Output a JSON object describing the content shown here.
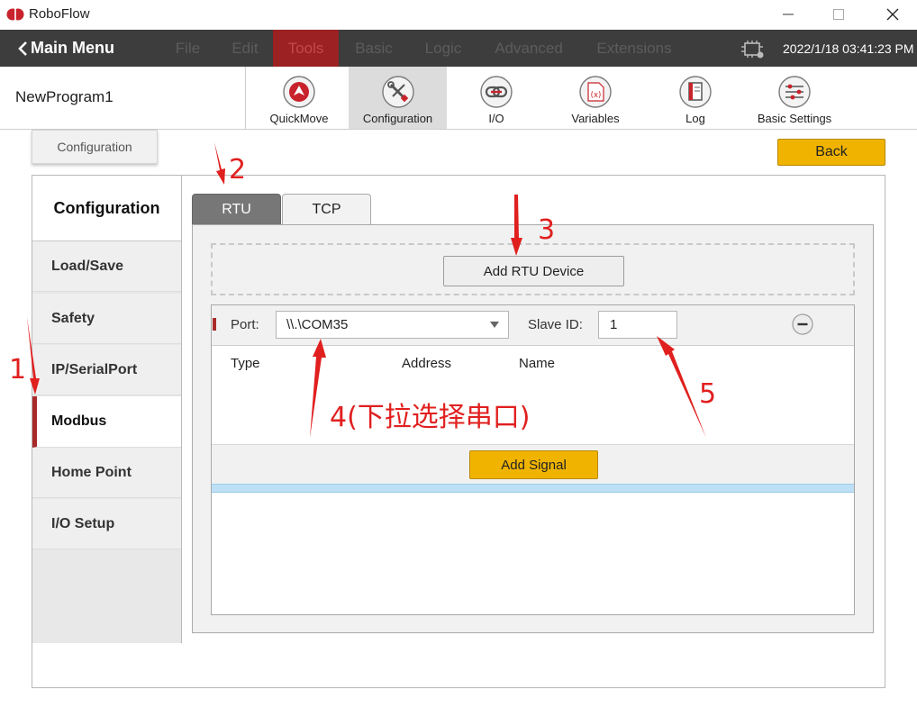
{
  "window": {
    "title": "RoboFlow",
    "controls": {
      "minimize": "minimize-icon",
      "maximize": "maximize-icon",
      "close": "close-icon"
    }
  },
  "menubar": {
    "main_menu": "Main Menu",
    "items": [
      "File",
      "Edit",
      "Tools",
      "Basic",
      "Logic",
      "Advanced",
      "Extensions"
    ],
    "active_item": "Tools",
    "datetime": "2022/1/18 03:41:23 PM"
  },
  "toolbar": {
    "program_name": "NewProgram1",
    "tools": [
      {
        "label": "QuickMove",
        "icon": "quickmove-icon"
      },
      {
        "label": "Configuration",
        "icon": "wrench-screwdriver-icon"
      },
      {
        "label": "I/O",
        "icon": "io-connector-icon"
      },
      {
        "label": "Variables",
        "icon": "variables-icon"
      },
      {
        "label": "Log",
        "icon": "log-book-icon"
      },
      {
        "label": "Basic Settings",
        "icon": "sliders-icon"
      }
    ],
    "active_tool": "Configuration"
  },
  "breadcrumb": "Configuration",
  "back_button": "Back",
  "sidebar": {
    "heading": "Configuration",
    "items": [
      "Load/Save",
      "Safety",
      "IP/SerialPort",
      "Modbus",
      "Home Point",
      "I/O Setup"
    ],
    "active_item": "Modbus"
  },
  "tabs": [
    "RTU",
    "TCP"
  ],
  "active_tab": "RTU",
  "rtu": {
    "add_device_button": "Add RTU Device",
    "device": {
      "port_label": "Port:",
      "port_value": "\\\\.\\COM35",
      "slave_id_label": "Slave ID:",
      "slave_id_value": "1",
      "columns": [
        "Type",
        "Address",
        "Name"
      ],
      "add_signal_button": "Add Signal"
    }
  },
  "annotations": {
    "step1": "1",
    "step2": "2",
    "step3": "3",
    "step4": "4(下拉选择串口)",
    "step5": "5"
  },
  "colors": {
    "accent_red": "#a92a2a",
    "button_yellow": "#f0b400",
    "menubar_bg": "#3d3d3d",
    "annotation_red": "#e0201f"
  }
}
